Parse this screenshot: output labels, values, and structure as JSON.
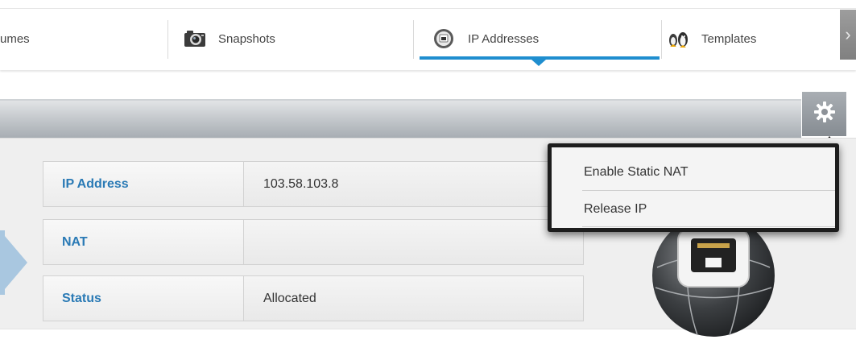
{
  "tabs": {
    "volumes": {
      "label": "umes",
      "icon": "volumes-icon"
    },
    "snapshots": {
      "label": "Snapshots",
      "icon": "camera-icon"
    },
    "ip_addresses": {
      "label": "IP Addresses",
      "icon": "ip-address-icon",
      "active": true
    },
    "templates": {
      "label": "Templates",
      "icon": "templates-icon"
    },
    "scroll_right": {
      "label": "›",
      "icon": "chevron-right-icon"
    }
  },
  "toolbar": {
    "gear_icon": "gear-icon"
  },
  "details": {
    "rows": [
      {
        "label": "IP Address",
        "value": "103.58.103.8"
      },
      {
        "label": "NAT",
        "value": ""
      },
      {
        "label": "Status",
        "value": "Allocated"
      }
    ]
  },
  "menu": {
    "items": [
      {
        "label": "Enable Static NAT"
      },
      {
        "label": "Release IP"
      }
    ]
  },
  "colors": {
    "accent": "#1f8ecf",
    "label_text": "#2a7ab5",
    "menu_frame": "#1d1d1d"
  }
}
